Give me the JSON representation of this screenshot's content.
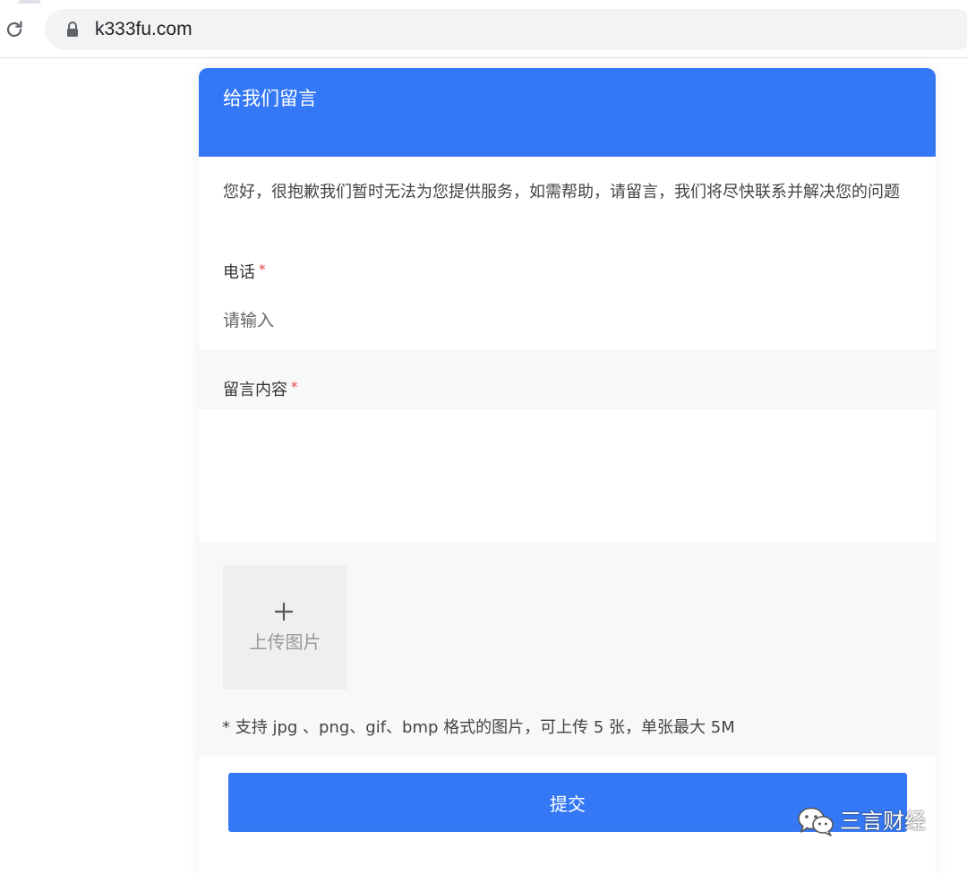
{
  "browser": {
    "url": "k333fu.com",
    "icons": [
      "reload-icon",
      "lock-icon"
    ]
  },
  "widget": {
    "title": "给我们留言",
    "intro": "您好，很抱歉我们暂时无法为您提供服务，如需帮助，请留言，我们将尽快联系并解决您的问题",
    "phone": {
      "label": "电话",
      "required_mark": "*",
      "placeholder": "请输入",
      "value": ""
    },
    "message": {
      "label": "留言内容",
      "required_mark": "*",
      "value": ""
    },
    "upload": {
      "icon": "plus-icon",
      "label": "上传图片",
      "note": "* 支持 jpg 、png、gif、bmp 格式的图片，可上传 5 张，单张最大 5M"
    },
    "submit_label": "提交"
  },
  "watermark": {
    "text": "三言财经",
    "icon": "wechat-icon"
  },
  "colors": {
    "accent": "#3478f6",
    "required": "#e64340",
    "band_background": "#f8f8f8",
    "upload_box": "#efefef"
  }
}
